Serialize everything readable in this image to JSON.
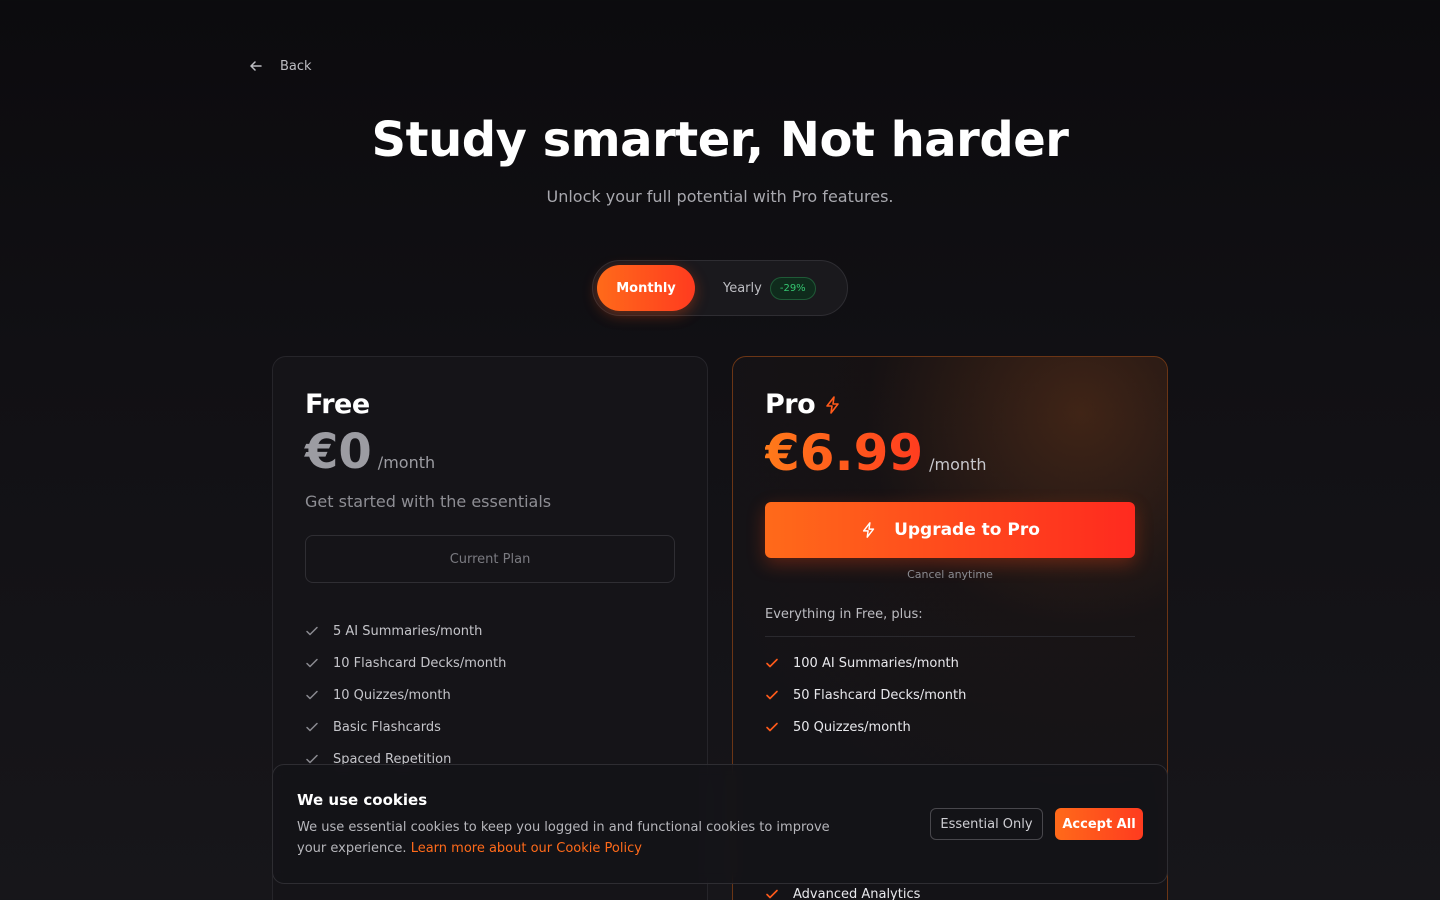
{
  "nav": {
    "back_label": "Back"
  },
  "hero": {
    "title": "Study smarter, Not harder",
    "subtitle": "Unlock your full potential with Pro features."
  },
  "billing_toggle": {
    "monthly_label": "Monthly",
    "yearly_label": "Yearly",
    "yearly_discount": "-29%",
    "selected": "Monthly"
  },
  "plans": {
    "free": {
      "name": "Free",
      "price": "€0",
      "period": "/month",
      "description": "Get started with the essentials",
      "button_label": "Current Plan",
      "features": [
        "5 AI Summaries/month",
        "10 Flashcard Decks/month",
        "10 Quizzes/month",
        "Basic Flashcards",
        "Spaced Repetition"
      ]
    },
    "pro": {
      "name": "Pro",
      "icon": "lightning-icon",
      "price": "€6.99",
      "period": "/month",
      "button_label": "Upgrade to Pro",
      "cancel_note": "Cancel anytime",
      "includes_label": "Everything in Free, plus:",
      "features": [
        "100 AI Summaries/month",
        "50 Flashcard Decks/month",
        "50 Quizzes/month",
        "Advanced Analytics"
      ]
    }
  },
  "cookie_banner": {
    "title": "We use cookies",
    "text": "We use essential cookies to keep you logged in and functional cookies to improve your experience.",
    "link_label": "Learn more about our Cookie Policy",
    "essential_label": "Essential Only",
    "accept_label": "Accept All"
  },
  "colors": {
    "accent": "#ff5a1a",
    "background": "#0c0b0e",
    "discount_green": "#35c671"
  }
}
